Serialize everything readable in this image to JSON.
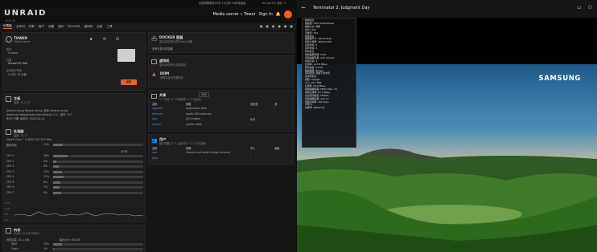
{
  "topbar": {
    "text": "试阅期限剩余29天·15分钟·54秒钟结束",
    "right": "Unraid OS 试用",
    "close": "✕"
  },
  "header": {
    "logo": "UNRAID",
    "version": "6.12.10",
    "server_label": "Media server • Tower",
    "signin": "Sign In"
  },
  "nav": {
    "items": [
      "仪表板",
      "主阵列",
      "共享",
      "用户",
      "设置",
      "插件",
      "DOCKER",
      "虚拟机",
      "应用",
      "工具"
    ]
  },
  "tower": {
    "name": "TOWER",
    "sub": "Media server",
    "model_label": "型号",
    "model": "Custom",
    "reg_label": "注册",
    "reg": "Unraid OS Trial",
    "uptime_label": "正常运行时间",
    "uptime": "4 小时, 33 分钟",
    "button": "编辑"
  },
  "mainboard": {
    "title": "主板",
    "temp": "温度: 37.0 °C",
    "line1": "Default string Default string, 版本 Default string",
    "line2": "American Megatrends International, LLC., 版本 5.27",
    "line3": "BIOS 日期: 版本日, 2024-04-10"
  },
  "cpu": {
    "title": "处理器",
    "temp": "温度: 31 °C",
    "model": "Intel® Core™ i3-N305 @ 2970 MHz",
    "overall_label": "整体负载",
    "overall": "11%",
    "threads": "30 秒",
    "cores": [
      {
        "label": "CPU 0",
        "pct": "16%",
        "val": 16
      },
      {
        "label": "CPU 1",
        "pct": "4%",
        "val": 4
      },
      {
        "label": "CPU 2",
        "pct": "6%",
        "val": 6
      },
      {
        "label": "CPU 3",
        "pct": "10%",
        "val": 10
      },
      {
        "label": "CPU 4",
        "pct": "12%",
        "val": 12
      },
      {
        "label": "CPU 5",
        "pct": "8%",
        "val": 8
      },
      {
        "label": "CPU 6",
        "pct": "7%",
        "val": 7
      },
      {
        "label": "CPU 7",
        "pct": "9%",
        "val": 9
      }
    ],
    "y_ticks": [
      "15%",
      "10%",
      "5%",
      "0%"
    ]
  },
  "memory": {
    "title": "内存",
    "sub": "(RAM: 32 GiB DDR5)",
    "usable": "可用容量: 31.1 GiB",
    "max": "最大大小: 64 GiB",
    "rows": [
      {
        "label": "RAM",
        "pct": "10%"
      },
      {
        "label": "Flash",
        "pct": "1%"
      }
    ]
  },
  "docker": {
    "title": "DOCKER 容器",
    "sub": "显示启动/停止的Docker容器",
    "empty": "没有可显示的容器"
  },
  "vm": {
    "title": "虚拟机",
    "sub": "显示启动/停止的虚拟机",
    "dom_label": "DOM",
    "dom_sub": "没有可显示的虚拟机"
  },
  "shares": {
    "title": "共享",
    "count": "4 个共享, 0 个不受保护, 0 个已启动",
    "select": "SMB",
    "cols": [
      "名称",
      "说明",
      "安全性",
      "流"
    ],
    "rows": [
      {
        "name": "appdata",
        "desc": "application data",
        "sec": "-",
        "str": "-"
      },
      {
        "name": "domains",
        "desc": "saved VM instances",
        "sec": "-",
        "str": "-"
      },
      {
        "name": "isos",
        "desc": "ISO images",
        "sec": "私有",
        "str": "-"
      },
      {
        "name": "system",
        "desc": "system data",
        "sec": "-",
        "str": "-"
      }
    ]
  },
  "users": {
    "title": "用户",
    "count": "用户数据: 2 个, 活动中 0 个, 0 个已关闭",
    "cols": [
      "名称",
      "说明",
      "写入",
      "读取"
    ],
    "rows": [
      {
        "name": "root",
        "desc": "Console and webGui login account",
        "w": "-",
        "r": "-"
      },
      {
        "name": "jiyeli",
        "desc": "",
        "w": "-",
        "r": "-"
      }
    ]
  },
  "player": {
    "title": "Terminator 2: Judgment Day",
    "brand": "SAMSUNG"
  },
  "stats": {
    "lines": [
      {
        "h": true,
        "t": "播放信息"
      },
      {
        "t": "播放器: Html Video Player"
      },
      {
        "t": "播放方式: 转码"
      },
      {
        "t": "协议: http"
      },
      {
        "t": "流类型: HLS"
      },
      {
        "h": true,
        "t": "视频信息"
      },
      {
        "t": "播放器尺寸: 1919x1919"
      },
      {
        "t": "视频分辨率: 3840x2160"
      },
      {
        "t": "丢弃的帧: 0"
      },
      {
        "t": "损坏的帧: 0"
      },
      {
        "h": true,
        "t": "转码信息"
      },
      {
        "t": "视频编解码器: h264"
      },
      {
        "t": "音频编解码器: AAC (direct)"
      },
      {
        "t": "音频声道: 2"
      },
      {
        "t": "比特率: 112.8 Mbps"
      },
      {
        "t": "转码进度: 11.6%"
      },
      {
        "t": "转码帧率: 69 fps"
      },
      {
        "t": "转码原因: 容器不受支持"
      },
      {
        "h": true,
        "t": "媒体源信息"
      },
      {
        "t": "容器: mpegts"
      },
      {
        "t": "大小: 76.1 MiB"
      },
      {
        "t": "比特率: 67.8 Mbps"
      },
      {
        "t": "视频编解码器: HEVC Main 10"
      },
      {
        "t": "视频比特率: 67.6 Mbps"
      },
      {
        "t": "动态范围类型: HDR10"
      },
      {
        "t": "音频编解码器: AAC LC"
      },
      {
        "t": "音频比特率: 192 kbps"
      },
      {
        "t": "声道: 2"
      },
      {
        "t": "采样率: 48000 Hz"
      }
    ]
  },
  "colors": {
    "accent": "#e8632a",
    "link": "#5b8bd0"
  }
}
